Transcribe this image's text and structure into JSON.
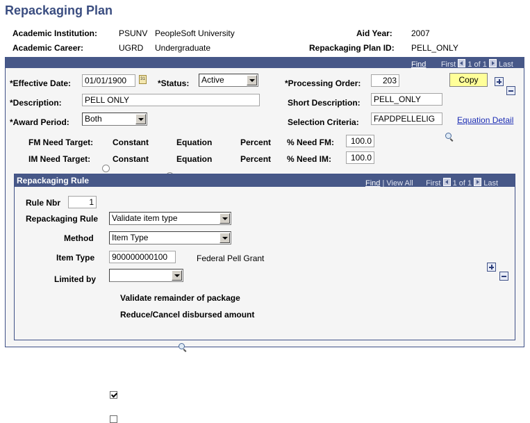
{
  "page": {
    "title": "Repackaging Plan"
  },
  "header": {
    "institution_label": "Academic Institution:",
    "institution_code": "PSUNV",
    "institution_name": "PeopleSoft University",
    "career_label": "Academic Career:",
    "career_code": "UGRD",
    "career_name": "Undergraduate",
    "aid_year_label": "Aid Year:",
    "aid_year": "2007",
    "plan_id_label": "Repackaging Plan ID:",
    "plan_id": "PELL_ONLY"
  },
  "main_nav": {
    "find": "Find",
    "first": "First",
    "count": "1 of 1",
    "last": "Last"
  },
  "form": {
    "effective_date_label": "*Effective Date:",
    "effective_date": "01/01/1900",
    "status_label": "*Status:",
    "status": "Active",
    "processing_order_label": "*Processing Order:",
    "processing_order": "203",
    "copy_label": "Copy",
    "description_label": "*Description:",
    "description": "PELL ONLY",
    "short_description_label": "Short Description:",
    "short_description": "PELL_ONLY",
    "award_period_label": "*Award Period:",
    "award_period": "Both",
    "selection_criteria_label": "Selection Criteria:",
    "selection_criteria": "FAPDPELLELIG",
    "equation_detail_link": "Equation Detail",
    "fm_need_target_label": "FM Need Target:",
    "im_need_target_label": "IM Need Target:",
    "target_options": [
      "Constant",
      "Equation",
      "Percent"
    ],
    "fm_need_target_selected": "Percent",
    "im_need_target_selected": "Percent",
    "pct_need_fm_label": "% Need FM:",
    "pct_need_fm": "100.0",
    "pct_need_im_label": "% Need IM:",
    "pct_need_im": "100.0"
  },
  "rule": {
    "section_title": "Repackaging Rule",
    "nav": {
      "find": "Find",
      "separator": "|",
      "view_all": "View All",
      "first": "First",
      "count": "1 of 1",
      "last": "Last"
    },
    "rule_nbr_label": "Rule Nbr",
    "rule_nbr": "1",
    "repackaging_rule_label": "Repackaging Rule",
    "repackaging_rule": "Validate item type",
    "method_label": "Method",
    "method": "Item Type",
    "item_type_label": "Item Type",
    "item_type": "900000000100",
    "item_type_description": "Federal Pell Grant",
    "limited_by_label": "Limited by",
    "limited_by": "",
    "validate_remainder_label": "Validate remainder of package",
    "validate_remainder_checked": true,
    "reduce_cancel_label": "Reduce/Cancel disbursed amount",
    "reduce_cancel_checked": false
  }
}
